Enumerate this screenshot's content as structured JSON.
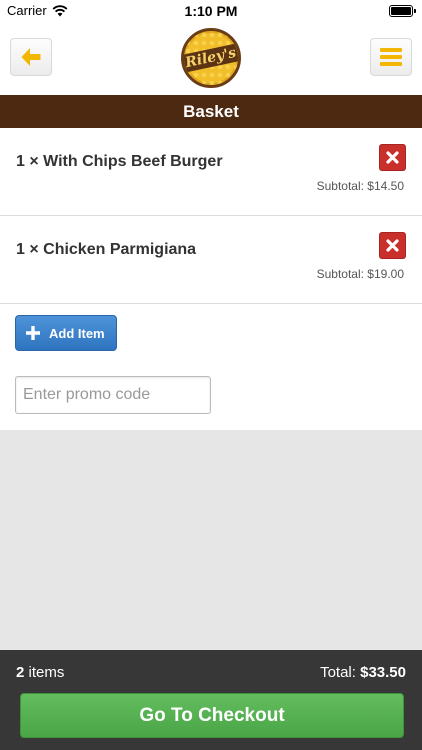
{
  "status_bar": {
    "carrier": "Carrier",
    "time": "1:10 PM"
  },
  "header": {
    "logo_text": "Riley's",
    "back_icon": "arrow-left-icon",
    "menu_icon": "hamburger-menu-icon"
  },
  "page": {
    "title": "Basket"
  },
  "basket": {
    "items": [
      {
        "quantity": "1",
        "name": "1 × With Chips Beef Burger",
        "subtotal": "Subtotal: $14.50"
      },
      {
        "quantity": "1",
        "name": "1 × Chicken Parmigiana",
        "subtotal": "Subtotal: $19.00"
      }
    ],
    "add_item_label": "Add Item",
    "promo_placeholder": "Enter promo code",
    "promo_value": ""
  },
  "summary": {
    "item_count": "2",
    "items_word": "items",
    "total_label": "Total:",
    "total_value": "$33.50",
    "checkout_label": "Go To Checkout"
  },
  "colors": {
    "title_bar": "#4e2912",
    "accent_yellow": "#f2b705",
    "remove_red": "#c9302c",
    "add_blue": "#3a80cc",
    "checkout_green": "#55b051",
    "bottom_bar": "#373737"
  }
}
